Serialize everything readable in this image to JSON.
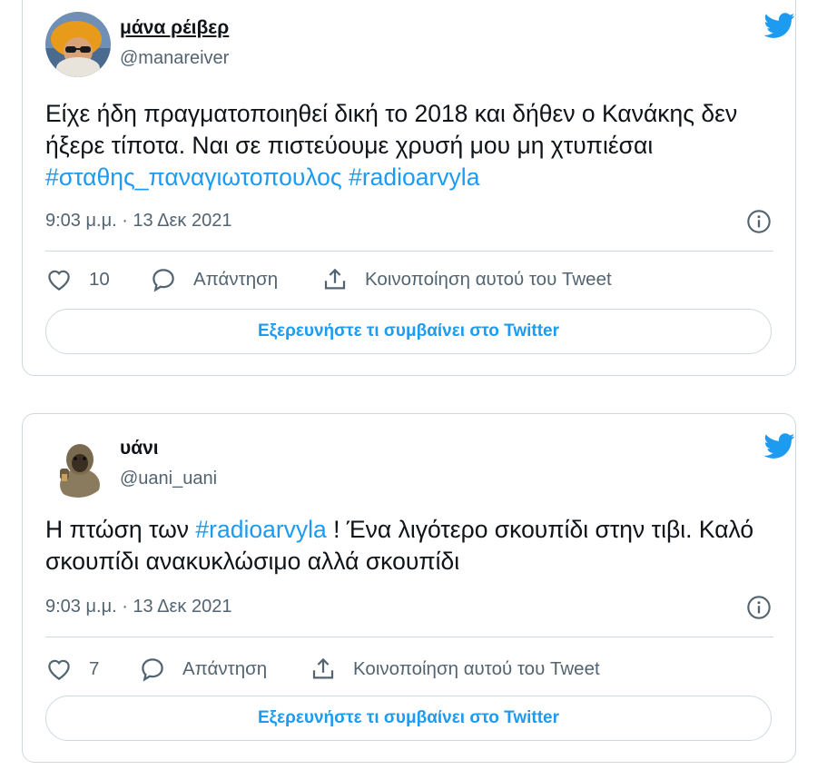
{
  "tweets": [
    {
      "name": "μάνα ρέιβερ",
      "handle": "@manareiver",
      "text_plain": "Είχε ήδη πραγματοποιηθεί δική το 2018 και δήθεν ο Κανάκης δεν ήξερε τίποτα. Ναι σε πιστεύουμε χρυσή μου μη χτυπιέσαι  ",
      "hashtag_1": "#σταθης_παναγιωτοπουλος",
      "hashtag_2": "#radioarvyla",
      "timestamp": "9:03 μ.μ. · 13 Δεκ 2021",
      "likes": "10",
      "reply_label": "Απάντηση",
      "share_label": "Κοινοποίηση αυτού του Tweet",
      "explore_label": "Εξερευνήστε τι συμβαίνει στο Twitter"
    },
    {
      "name": "υάνι",
      "handle": "@uani_uani",
      "text_before": "Η πτώση των ",
      "hashtag_1": "#radioarvyla",
      "text_after": " ! Ένα λιγότερο σκουπίδι στην τιβι. Καλό σκουπίδι ανακυκλώσιμο αλλά σκουπίδι",
      "timestamp": "9:03 μ.μ. · 13 Δεκ 2021",
      "likes": "7",
      "reply_label": "Απάντηση",
      "share_label": "Κοινοποίηση αυτού του Tweet",
      "explore_label": "Εξερευνήστε τι συμβαίνει στο Twitter"
    }
  ],
  "colors": {
    "accent": "#1d9bf0",
    "text": "#0f1419",
    "secondary": "#536471",
    "border": "#cfd9de"
  },
  "icons": [
    "twitter-bird-icon",
    "info-icon",
    "heart-icon",
    "reply-bubble-icon",
    "share-icon"
  ]
}
